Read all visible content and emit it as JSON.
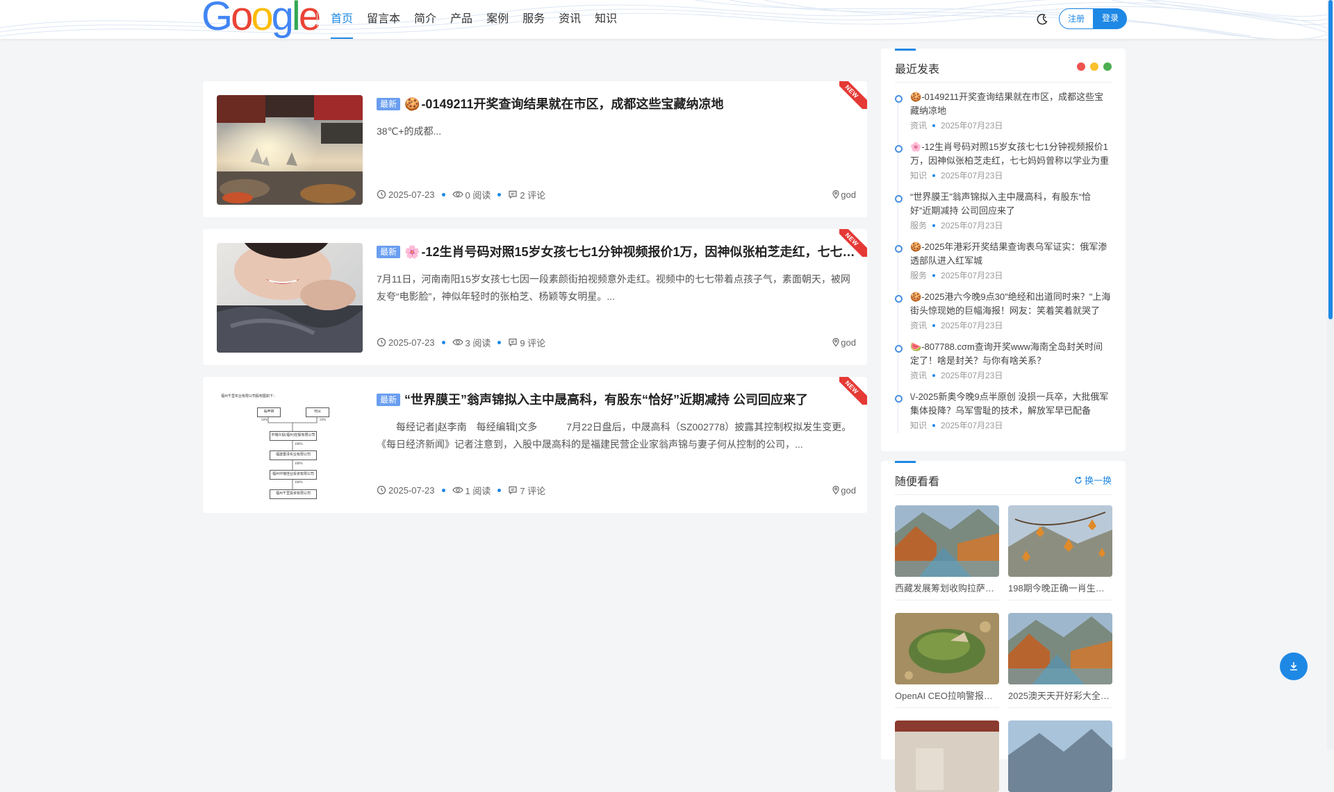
{
  "header": {
    "logo_letters": [
      "G",
      "o",
      "o",
      "g",
      "l",
      "e"
    ],
    "logo_colors": [
      "#4285f4",
      "#ea4335",
      "#fbbc05",
      "#4285f4",
      "#34a853",
      "#ea4335"
    ],
    "nav": [
      "首页",
      "留言本",
      "简介",
      "产品",
      "案例",
      "服务",
      "资讯",
      "知识"
    ],
    "register_label": "注册",
    "login_label": "登录"
  },
  "colors": {
    "accent": "#1e88e5",
    "badge": "#6a9ef0",
    "new_ribbon": "#e53935"
  },
  "posts": [
    {
      "badge": "最新",
      "emoji": "🍪",
      "title": "-0149211开奖查询结果就在市区，成都这些宝藏纳凉地",
      "excerpt": "38℃+的成都...",
      "date": "2025-07-23",
      "views": "0 阅读",
      "comments": "2 评论",
      "author": "god",
      "ribbon": "NEW"
    },
    {
      "badge": "最新",
      "emoji": "🌸",
      "title": "-12生肖号码对照15岁女孩七七1分钟视频报价1万，因神似张柏芝走红，七七妈妈曾称以学业为重",
      "excerpt": "7月11日，河南南阳15岁女孩七七因一段素颜街拍视频意外走红。视频中的七七带着点孩子气，素面朝天，被网友夸“电影脸”，神似年轻时的张柏芝、杨颖等女明星。...",
      "date": "2025-07-23",
      "views": "3 阅读",
      "comments": "9 评论",
      "author": "god",
      "ribbon": "NEW"
    },
    {
      "badge": "最新",
      "emoji": "",
      "title": "“世界膜王”翁声锦拟入主中晟高科，有股东“恰好”近期减持 公司回应来了",
      "excerpt": "　　每经记者|赵李南　每经编辑|文多　　　7月22日盘后，中晟高科（SZ002778）披露其控制权拟发生变更。《每日经济新闻》记者注意到，入股中晟高科的是福建民营企业家翁声锦与妻子何从控制的公司，...",
      "date": "2025-07-23",
      "views": "1 阅读",
      "comments": "7 评论",
      "author": "god",
      "ribbon": "NEW"
    }
  ],
  "org_chart": {
    "header": "福州千里实业有限公司股权图如下：",
    "top_left": "翁声锦",
    "top_right": "何从",
    "pct_left": "50%",
    "pct_right": "50%",
    "boxes": [
      "中瑞众投(福州)控股有限公司",
      "福建晋泽实业有限公司",
      "福州中瑞佳业投资有限公司",
      "福州千里投资有限公司"
    ],
    "pcts": [
      "100%",
      "100%",
      "100%",
      "100%"
    ]
  },
  "recent": {
    "title": "最近发表",
    "dot_colors": [
      "#ef5350",
      "#fbc02d",
      "#4caf50"
    ],
    "items": [
      {
        "emoji": "🍪",
        "title": "-0149211开奖查询结果就在市区，成都这些宝藏纳凉地",
        "cat": "资讯",
        "date": "2025年07月23日"
      },
      {
        "emoji": "🌸",
        "title": "-12生肖号码对照15岁女孩七七1分钟视频报价1万，因神似张柏芝走红，七七妈妈曾称以学业为重",
        "cat": "知识",
        "date": "2025年07月23日"
      },
      {
        "emoji": "",
        "title": "“世界膜王”翁声锦拟入主中晟高科，有股东“恰好”近期减持 公司回应来了",
        "cat": "服务",
        "date": "2025年07月23日"
      },
      {
        "emoji": "🍪",
        "title": "-2025年港彩开奖结果查询表乌军证实：俄军渗透部队进入红军城",
        "cat": "服务",
        "date": "2025年07月23日"
      },
      {
        "emoji": "🍪",
        "title": "-2025港六今晚9点30\"绝经和出道同时来？\"上海街头惊现她的巨幅海报！网友：笑着笑着就哭了",
        "cat": "资讯",
        "date": "2025年07月23日"
      },
      {
        "emoji": "🍉",
        "title": "-807788.cσm查询开奖www海南全岛封关时间定了！啥是封关？与你有啥关系？",
        "cat": "资讯",
        "date": "2025年07月23日"
      },
      {
        "emoji": "\\/",
        "title": "-2025新奥今晚9点半原创 没损一兵卒，大批俄军集体投降？乌军雪耻的技术，解放军早已配备",
        "cat": "知识",
        "date": "2025年07月23日"
      }
    ]
  },
  "random": {
    "title": "随便看看",
    "refresh_label": "换一换",
    "items": [
      {
        "caption": "西藏发展筹划收购拉萨…"
      },
      {
        "caption": "198期今晚正确一肖生…"
      },
      {
        "caption": "OpenAI CEO拉响警报…"
      },
      {
        "caption": "2025澳天天开好彩大全…"
      }
    ]
  }
}
